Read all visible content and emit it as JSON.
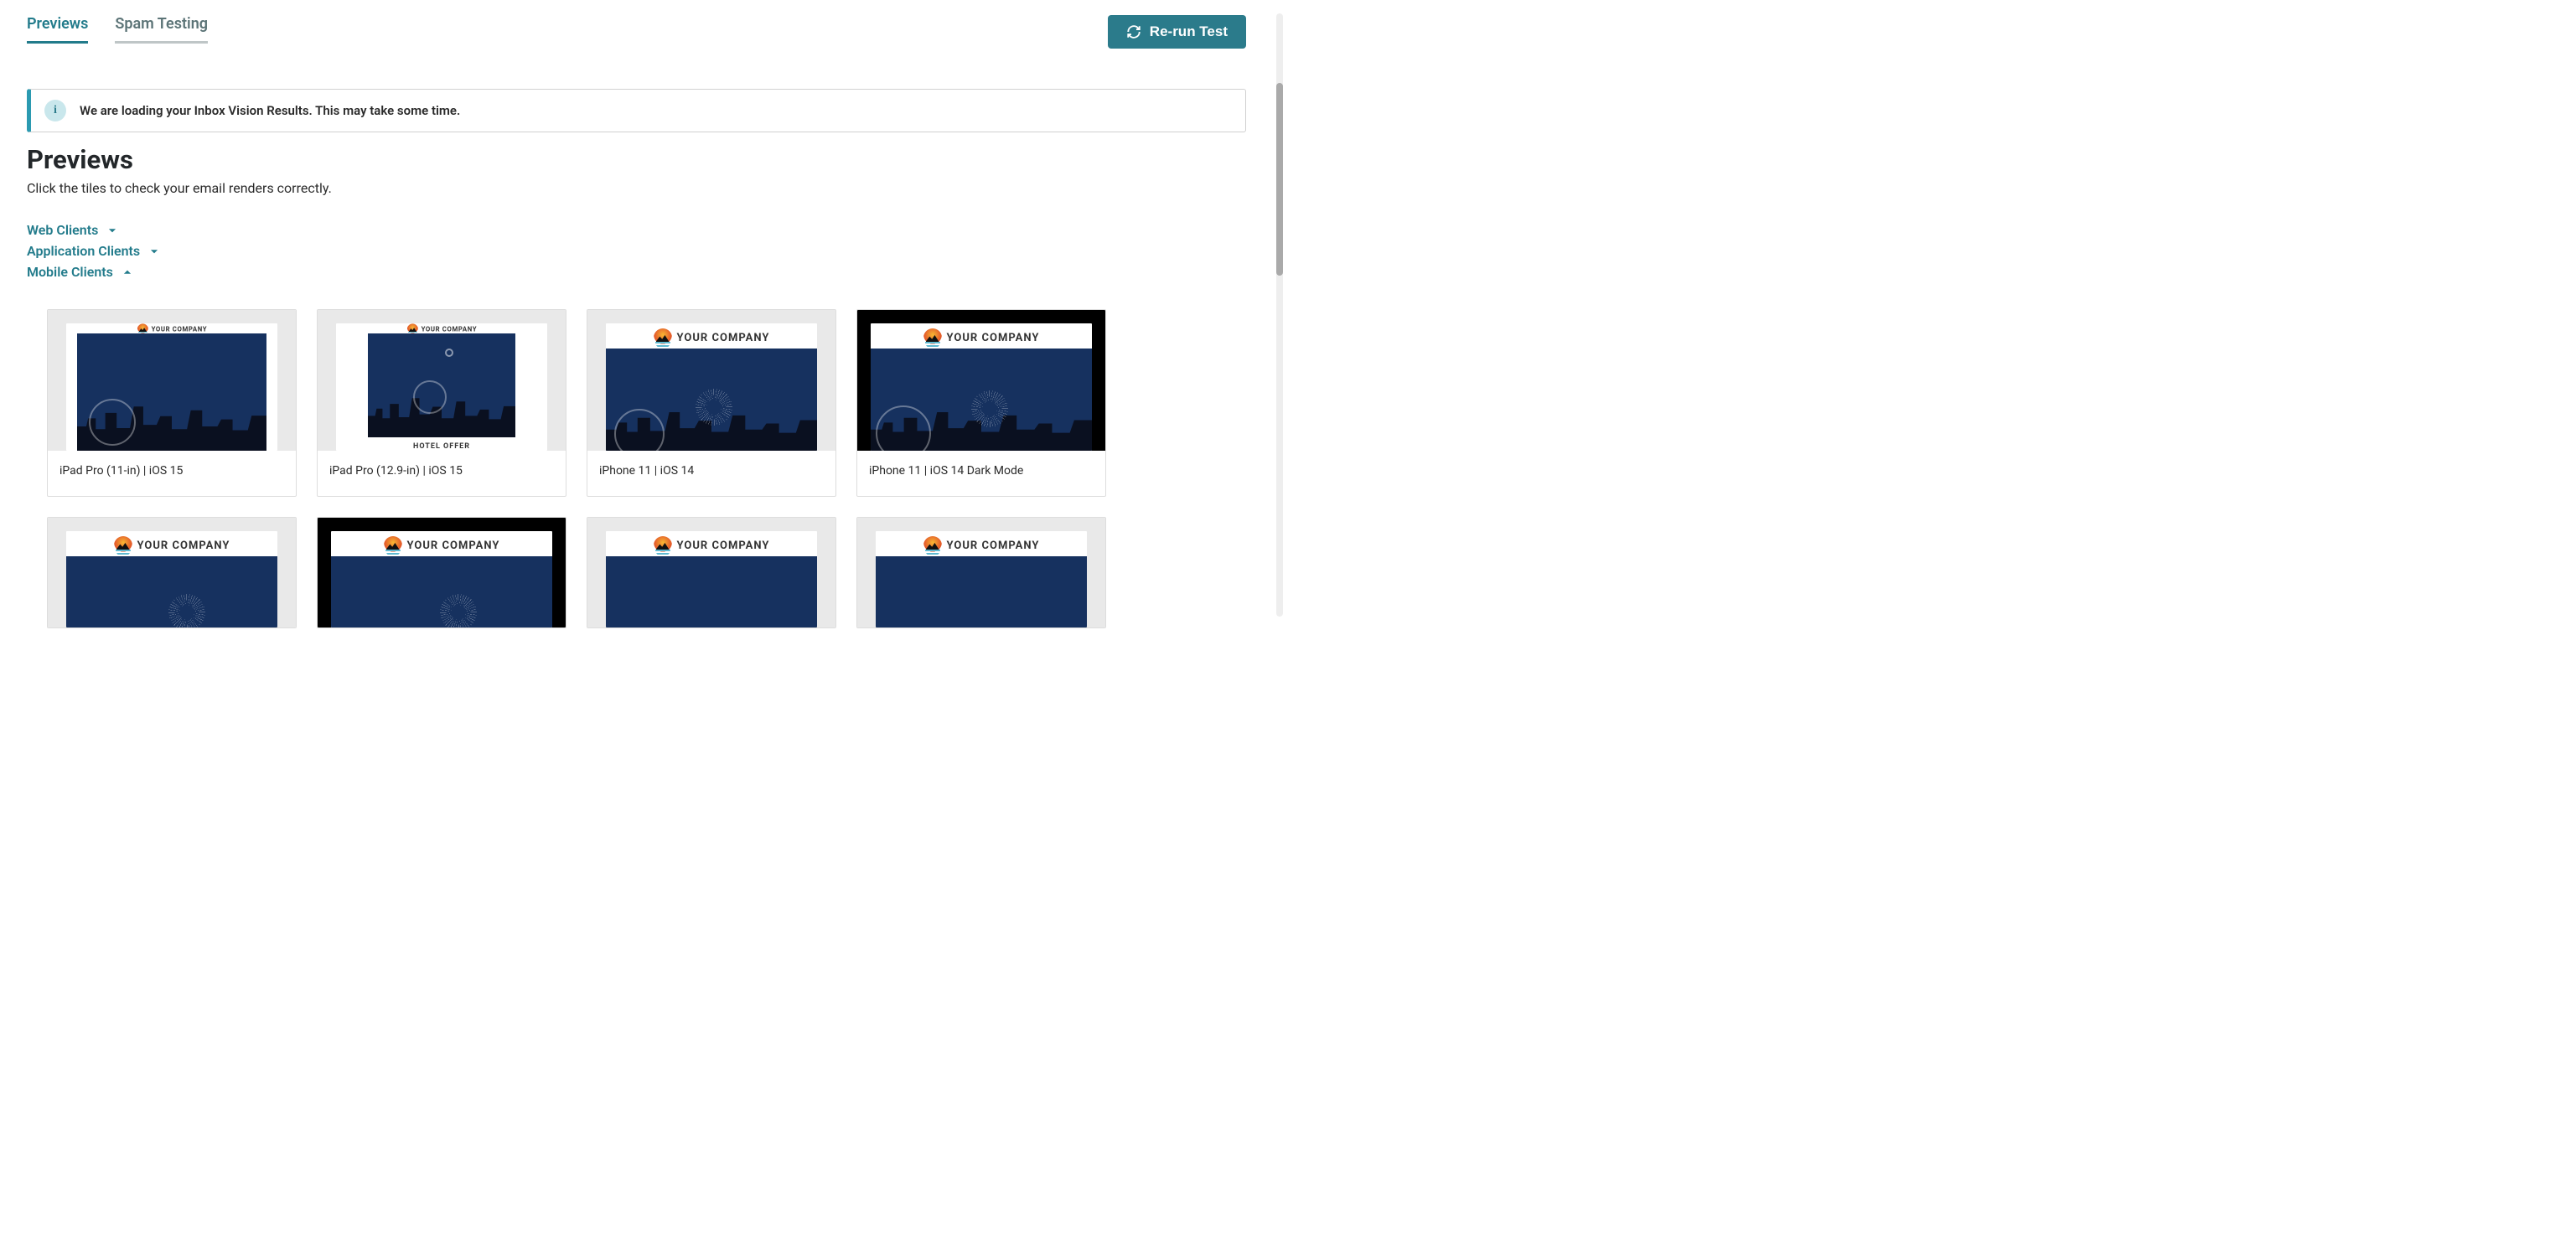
{
  "tabs": {
    "previews": "Previews",
    "spam": "Spam Testing"
  },
  "rerun_label": "Re-run Test",
  "notice": "We are loading your Inbox Vision Results. This may take some time.",
  "title": "Previews",
  "subtitle": "Click the tiles to check your email renders correctly.",
  "groups": {
    "web": "Web Clients",
    "app": "Application Clients",
    "mobile": "Mobile Clients"
  },
  "logo_text": "YOUR COMPANY",
  "hotel_offer": "HOTEL OFFER",
  "tiles": [
    {
      "label": "iPad Pro (11-in) | iOS 15"
    },
    {
      "label": "iPad Pro (12.9-in) | iOS 15"
    },
    {
      "label": "iPhone 11 | iOS 14"
    },
    {
      "label": "iPhone 11 | iOS 14 Dark Mode"
    },
    {
      "label": ""
    },
    {
      "label": ""
    },
    {
      "label": ""
    },
    {
      "label": ""
    }
  ]
}
